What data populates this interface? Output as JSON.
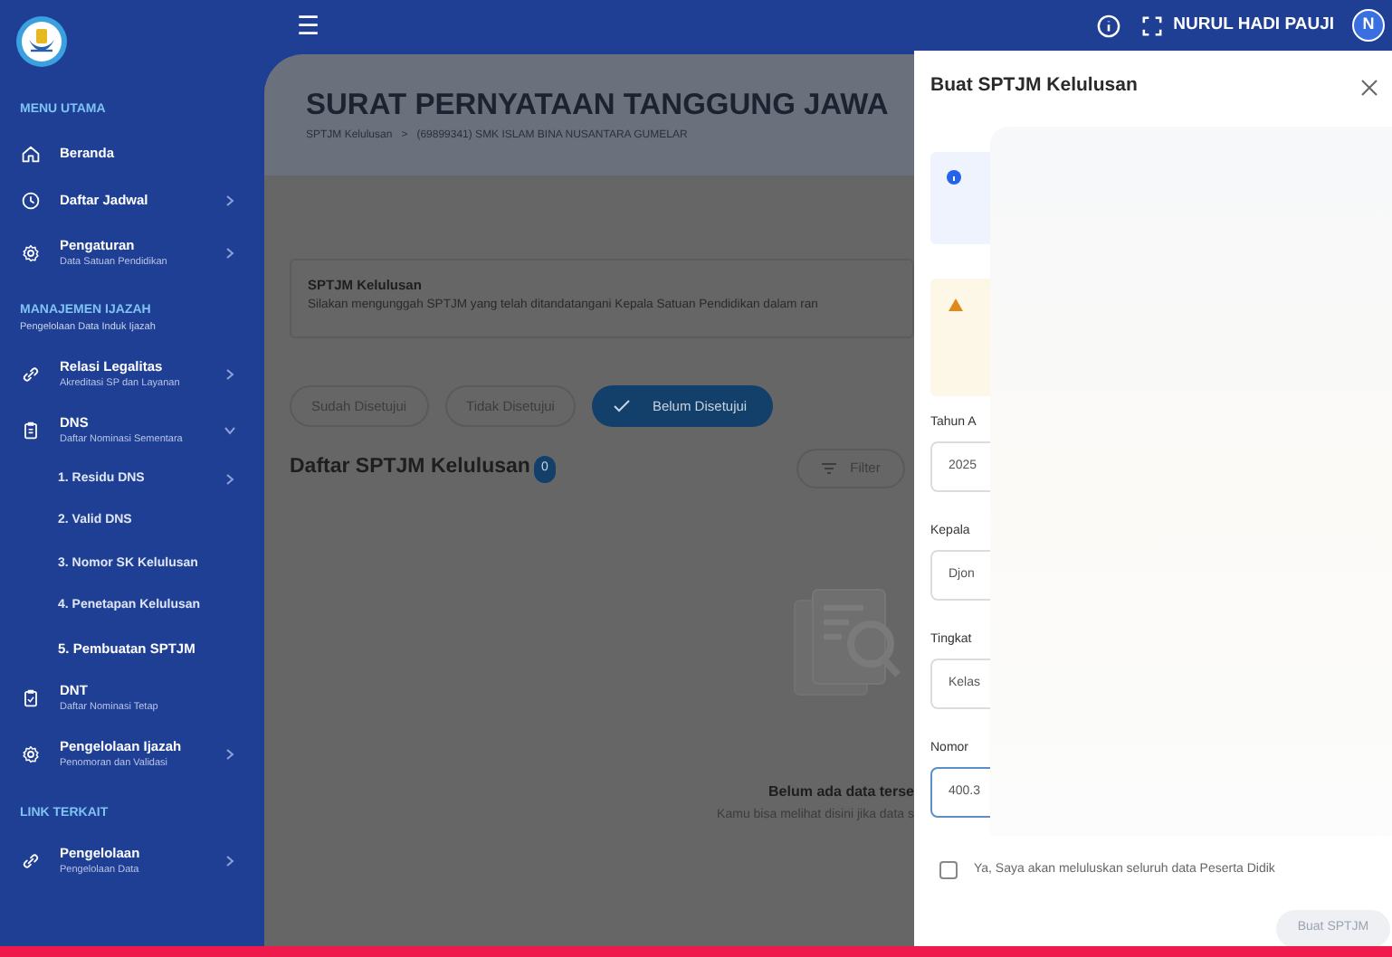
{
  "topbar": {
    "menu_glyph": "☰",
    "user_name": "NURUL HADI PAUJI",
    "avatar_letter": "N"
  },
  "sidebar": {
    "sections": [
      {
        "title": "MENU UTAMA",
        "items": [
          {
            "label": "Beranda",
            "kind": "home",
            "chevron": false
          },
          {
            "label": "Daftar Jadwal",
            "kind": "clock",
            "chevron": true
          },
          {
            "label": "Pengaturan",
            "subtitle": "Data Satuan Pendidikan",
            "kind": "gear",
            "chevron": true
          }
        ]
      },
      {
        "title": "MANAJEMEN IJAZAH",
        "subtitle": "Pengelolaan Data Induk Ijazah",
        "items": [
          {
            "label": "Relasi Legalitas",
            "subtitle": "Akreditasi SP dan Layanan",
            "kind": "link",
            "chevron": true
          },
          {
            "label": "DNS",
            "subtitle": "Daftar Nominasi Sementara",
            "kind": "clipboard",
            "chevron": true,
            "expanded": true,
            "children": [
              {
                "label": "1. Residu DNS",
                "chevron": true,
                "selected": false
              },
              {
                "label": "2. Valid DNS",
                "chevron": false,
                "selected": false
              },
              {
                "label": "3. Nomor SK Kelulusan",
                "chevron": false,
                "selected": false
              },
              {
                "label": "4. Penetapan Kelulusan",
                "chevron": false,
                "selected": false
              },
              {
                "label": "5. Pembuatan SPTJM",
                "chevron": false,
                "selected": true
              }
            ]
          },
          {
            "label": "DNT",
            "subtitle": "Daftar Nominasi Tetap",
            "kind": "checklist",
            "chevron": false
          },
          {
            "label": "Pengelolaan Ijazah",
            "subtitle": "Penomoran dan Validasi",
            "kind": "gear",
            "chevron": true
          }
        ]
      },
      {
        "title": "LINK TERKAIT",
        "items": [
          {
            "label": "Pengelolaan",
            "subtitle": "Pengelolaan Data",
            "kind": "link",
            "chevron": true
          }
        ]
      }
    ]
  },
  "page": {
    "title": "SURAT PERNYATAAN TANGGUNG JAWA",
    "breadcrumb": [
      "SPTJM Kelulusan",
      "(69899341) SMK ISLAM BINA NUSANTARA GUMELAR"
    ],
    "breadcrumb_separator": ">",
    "notice": {
      "title": "SPTJM Kelulusan",
      "text": "Silakan mengunggah SPTJM yang telah ditandatangani Kepala Satuan Pendidikan dalam ran"
    },
    "tabs": [
      {
        "label": "Sudah Disetujui",
        "selected": false
      },
      {
        "label": "Tidak Disetujui",
        "selected": false
      },
      {
        "label": "Belum Disetujui",
        "selected": true
      }
    ],
    "list_title": "Daftar SPTJM Kelulusan",
    "count": "0",
    "filter_label": "Filter",
    "empty": {
      "title": "Belum ada data terse",
      "text": "Kamu bisa melihat disini jika data s"
    }
  },
  "drawer": {
    "title": "Buat SPTJM Kelulusan",
    "fields": [
      {
        "label": "Tahun A",
        "value": "2025",
        "focused": false
      },
      {
        "label": "Kepala",
        "value": "Djon",
        "focused": false
      },
      {
        "label": "Tingkat",
        "value": "Kelas",
        "focused": false
      },
      {
        "label": "Nomor",
        "value": "400.3",
        "focused": true
      }
    ],
    "agreement": {
      "label": "Ya, Saya akan meluluskan seluruh data Peserta Didik",
      "checked": false
    },
    "submit": {
      "label": "Buat SPTJM",
      "disabled": true
    }
  }
}
